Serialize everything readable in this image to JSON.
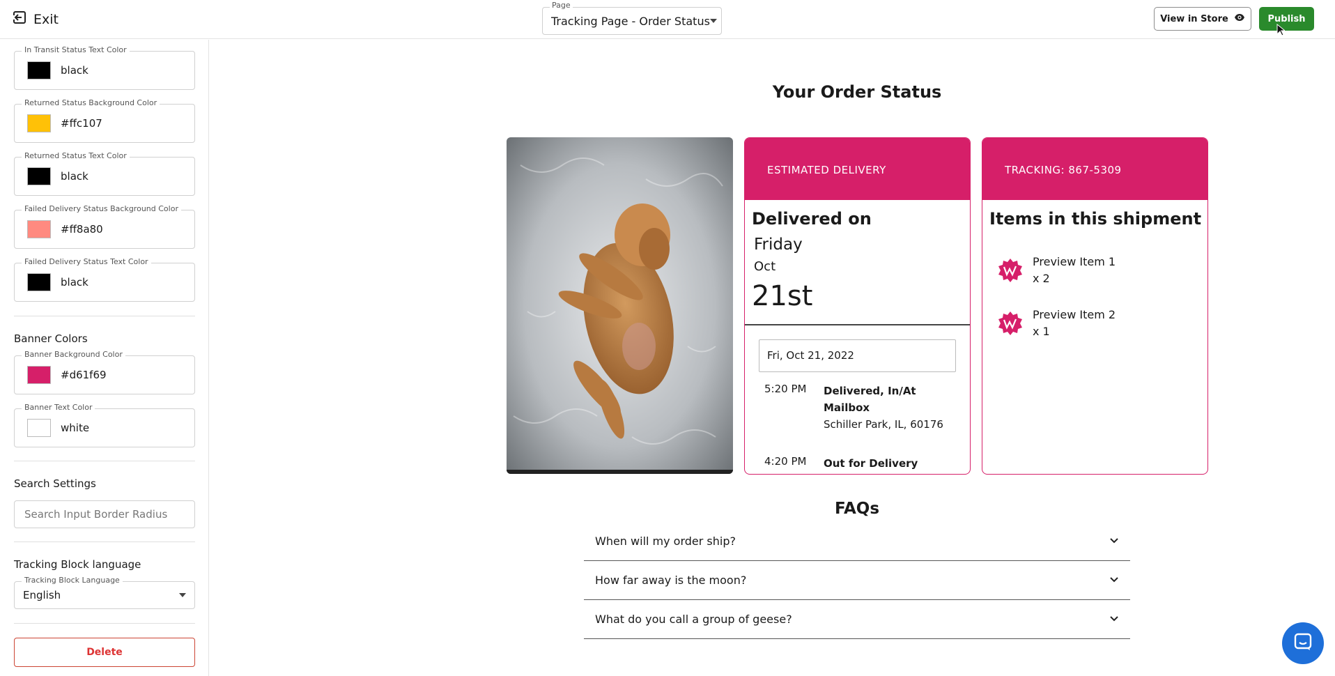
{
  "topbar": {
    "exit_label": "Exit",
    "page_select": {
      "legend": "Page",
      "value": "Tracking Page - Order Status"
    },
    "view_in_store_label": "View in Store",
    "publish_label": "Publish"
  },
  "sidebar": {
    "color_fields_top": [
      {
        "label": "In Transit Status Text Color",
        "value": "black",
        "color": "#000000"
      },
      {
        "label": "Returned Status Background Color",
        "value": "#ffc107",
        "color": "#ffc107"
      },
      {
        "label": "Returned Status Text Color",
        "value": "black",
        "color": "#000000"
      },
      {
        "label": "Failed Delivery Status Background Color",
        "value": "#ff8a80",
        "color": "#ff8a80"
      },
      {
        "label": "Failed Delivery Status Text Color",
        "value": "black",
        "color": "#000000"
      }
    ],
    "banner_section_title": "Banner Colors",
    "banner_fields": [
      {
        "label": "Banner Background Color",
        "value": "#d61f69",
        "color": "#d61f69"
      },
      {
        "label": "Banner Text Color",
        "value": "white",
        "color": "#ffffff"
      }
    ],
    "search_section_title": "Search Settings",
    "search_placeholder": "Search Input Border Radius",
    "language_section_title": "Tracking Block language",
    "language_select": {
      "legend": "Tracking Block Language",
      "value": "English"
    },
    "delete_label": "Delete"
  },
  "preview": {
    "title": "Your Order Status",
    "delivery_card": {
      "banner": "ESTIMATED DELIVERY",
      "delivered_on": "Delivered on",
      "day": "Friday",
      "month": "Oct",
      "date": "21st",
      "date_box": "Fri, Oct 21, 2022",
      "events": [
        {
          "time": "5:20 PM",
          "status": "Delivered, In/At Mailbox",
          "location": "Schiller Park, IL, 60176"
        },
        {
          "time": "4:20 PM",
          "status": "Out for Delivery",
          "location": ""
        }
      ]
    },
    "tracking_card": {
      "banner": "TRACKING: 867-5309",
      "items_title": "Items in this shipment",
      "items": [
        {
          "name": "Preview Item 1",
          "qty": "x 2"
        },
        {
          "name": "Preview Item 2",
          "qty": "x 1"
        }
      ]
    },
    "faq_title": "FAQs",
    "faqs": [
      "When will my order ship?",
      "How far away is the moon?",
      "What do you call a group of geese?"
    ]
  },
  "colors": {
    "brand_pink": "#d61f69",
    "publish_green": "#2a8a2c",
    "chat_blue": "#1e6fd9"
  },
  "icons": [
    "exit-icon",
    "eye-icon",
    "chevron-down-icon",
    "brand-logo-icon",
    "chat-icon",
    "mouse-cursor-icon"
  ]
}
